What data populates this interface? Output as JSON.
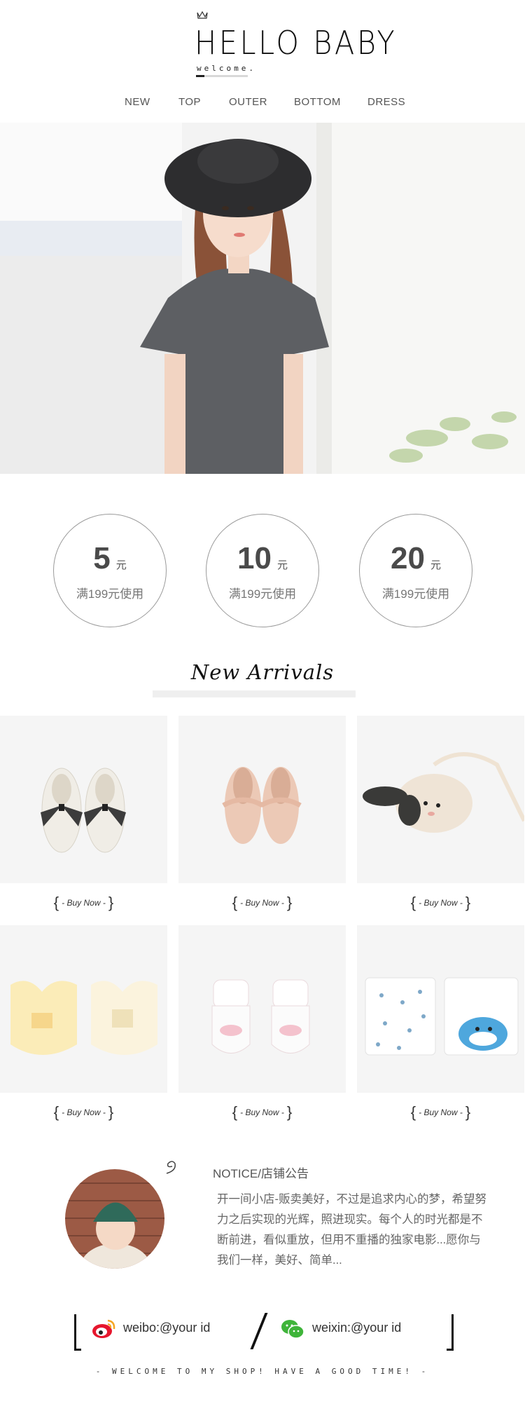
{
  "header": {
    "logo": "HELLO BABY",
    "logo_sub": "welcome.",
    "nav": [
      "NEW",
      "TOP",
      "OUTER",
      "BOTTOM",
      "DRESS"
    ]
  },
  "coupons": [
    {
      "amount": "5",
      "unit": "元",
      "condition": "满199元使用"
    },
    {
      "amount": "10",
      "unit": "元",
      "condition": "满199元使用"
    },
    {
      "amount": "20",
      "unit": "元",
      "condition": "满199元使用"
    }
  ],
  "new_arrivals": {
    "title": "New Arrivals",
    "buy_label": "- Buy Now -",
    "products": [
      {
        "icon": "white-shoes-with-plaid-bow"
      },
      {
        "icon": "pink-ruffle-shoes"
      },
      {
        "icon": "bunny-shoulder-bag"
      },
      {
        "icon": "baby-bibs"
      },
      {
        "icon": "baby-socks"
      },
      {
        "icon": "baby-tshirts"
      }
    ]
  },
  "notice": {
    "title": "NOTICE/店铺公告",
    "lines": [
      "开一间小店-贩卖美好，不过是追求内心的梦，希望努",
      "力之后实现的光辉，照进现实。每个人的时光都是不",
      "断前进，看似重放，但用不重播的独家电影...愿你与",
      "我们一样，美好、简单..."
    ]
  },
  "social": {
    "weibo": "weibo:@your id",
    "weixin": "weixin:@your id"
  },
  "footer": "- WELCOME TO MY SHOP! HAVE A GOOD TIME! -",
  "colors": {
    "text": "#555555",
    "circle_border": "#9a9a9a",
    "weibo_red": "#e6162d",
    "wechat_green": "#3fb43a"
  }
}
